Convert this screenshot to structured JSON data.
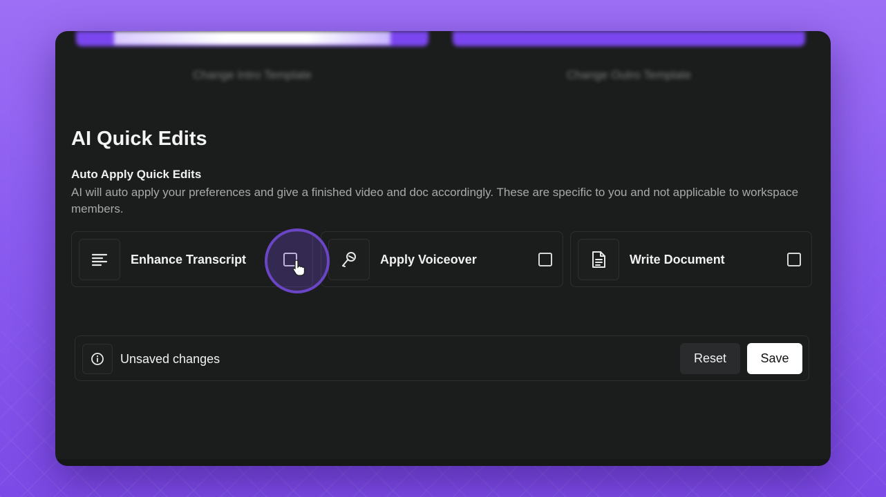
{
  "templates": {
    "intro_caption": "Change Intro Template",
    "outro_caption": "Change Outro Template"
  },
  "section": {
    "title": "AI Quick Edits",
    "subtitle": "Auto Apply Quick Edits",
    "description": "AI will auto apply your preferences and give a finished video and doc accordingly. These are specific to you and not applicable to workspace members."
  },
  "options": [
    {
      "label": "Enhance Transcript",
      "icon": "text-lines-icon",
      "checked": false
    },
    {
      "label": "Apply Voiceover",
      "icon": "microphone-icon",
      "checked": false
    },
    {
      "label": "Write Document",
      "icon": "document-icon",
      "checked": false
    }
  ],
  "savebar": {
    "status": "Unsaved changes",
    "reset_label": "Reset",
    "save_label": "Save"
  },
  "colors": {
    "accent": "#7b46f0",
    "panel": "#1b1c1c",
    "border": "#2e2f30"
  }
}
